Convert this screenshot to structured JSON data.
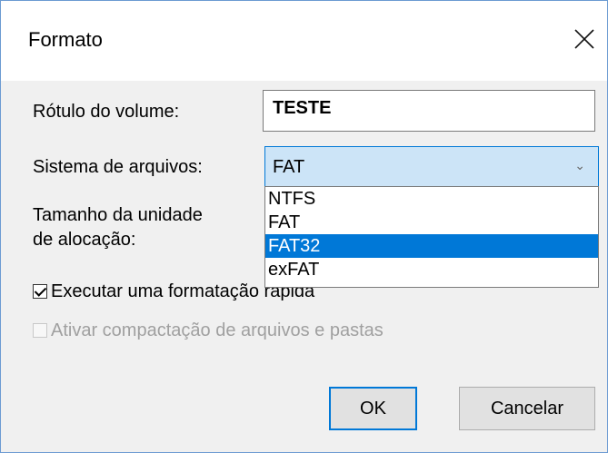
{
  "window": {
    "title": "Formato"
  },
  "form": {
    "volume_label_label": "Rótulo do volume:",
    "volume_label_value": "TESTE",
    "filesystem_label": "Sistema de arquivos:",
    "filesystem_value": "FAT",
    "filesystem_options": [
      "NTFS",
      "FAT",
      "FAT32",
      "exFAT"
    ],
    "filesystem_highlighted": "FAT32",
    "alloc_label_line1": "Tamanho da unidade",
    "alloc_label_line2": "de alocação:",
    "quick_format_label": "Executar uma formatação rápida",
    "quick_format_checked": true,
    "compress_label": "Ativar compactação de arquivos e pastas",
    "compress_checked": false,
    "compress_enabled": false
  },
  "buttons": {
    "ok": "OK",
    "cancel": "Cancelar"
  },
  "icons": {
    "close": "close-icon",
    "chevron": "chevron-down-icon"
  },
  "colors": {
    "accent": "#0078d7",
    "combo_bg": "#cce4f7",
    "dialog_bg": "#f0f0f0"
  }
}
